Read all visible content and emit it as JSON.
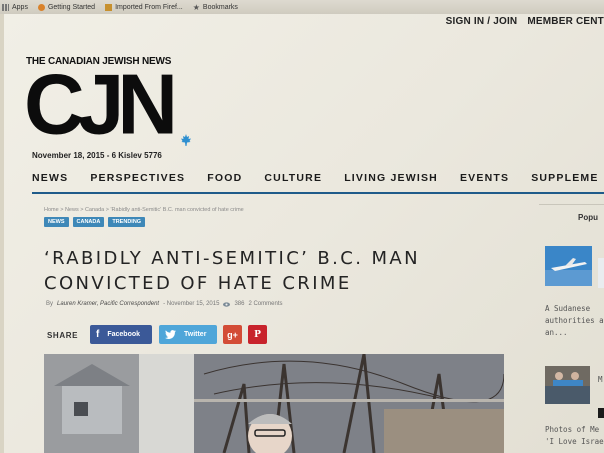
{
  "browser": {
    "bookmarks": [
      {
        "label": "Apps",
        "icon": "apps-icon"
      },
      {
        "label": "Getting Started",
        "icon": "firefox-icon"
      },
      {
        "label": "Imported From Firef...",
        "icon": "folder-icon"
      },
      {
        "label": "Bookmarks",
        "icon": "star-icon"
      }
    ]
  },
  "header": {
    "sign_in": "SIGN IN / JOIN",
    "member": "MEMBER CENT",
    "logo_kicker": "THE CANADIAN JEWISH NEWS",
    "logo": "CJN",
    "date": "November 18, 2015 - 6 Kislev 5776"
  },
  "nav": {
    "items": [
      "NEWS",
      "PERSPECTIVES",
      "FOOD",
      "CULTURE",
      "LIVING JEWISH",
      "EVENTS",
      "SUPPLEME"
    ]
  },
  "article": {
    "breadcrumb": "Home  >  News  >  Canada  >  'Rabidly anti-Semitic' B.C. man convicted of hate crime",
    "tags": [
      "NEWS",
      "CANADA",
      "TRENDING"
    ],
    "headline_line1": "‘RABIDLY ANTI-SEMITIC’ B.C. MAN",
    "headline_line2": "CONVICTED OF HATE CRIME",
    "byline_prefix": "By",
    "author": "Lauren Kramer, Pacific Correspondent",
    "date": "- November 15, 2015",
    "views": "386",
    "comments": "2 Comments"
  },
  "share": {
    "label": "SHARE",
    "facebook": "Facebook",
    "twitter": "Twitter",
    "google": "g+",
    "pinterest": "P"
  },
  "sidebar": {
    "title": "Popu",
    "item1_lines": [
      "A Sudanese",
      "authorities a",
      "an..."
    ],
    "item2_lines": [
      "Photos of Me",
      "'I Love Israe"
    ],
    "item2_label": "M"
  },
  "colors": {
    "nav_rule": "#1f5b8a",
    "tag": "#3e88b8",
    "facebook": "#3b5998",
    "twitter": "#4fa6d9",
    "google": "#d34c36",
    "pinterest": "#c8232c"
  }
}
